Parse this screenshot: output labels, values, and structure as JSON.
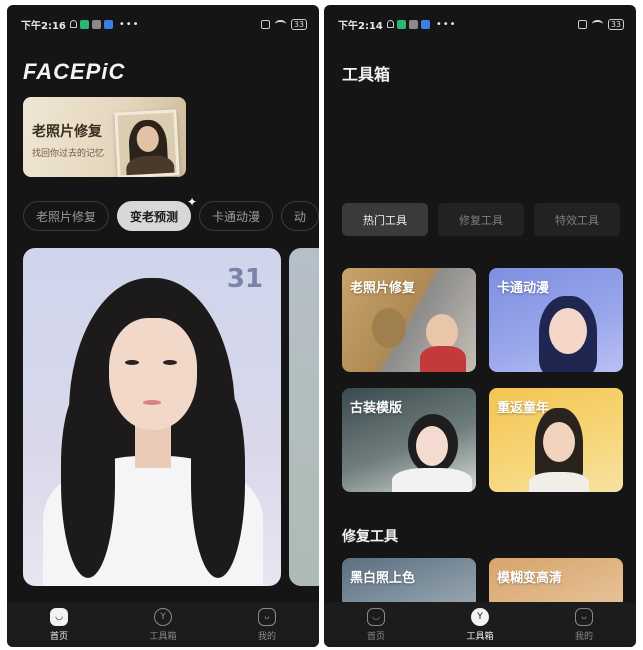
{
  "left": {
    "status": {
      "time": "下午2:16",
      "battery": "33"
    },
    "logo": "FACEPiC",
    "banner": {
      "title": "老照片修复",
      "subtitle": "找回你过去的记忆"
    },
    "chips": [
      "老照片修复",
      "变老预测",
      "卡通动漫",
      "动"
    ],
    "active_chip": "变老预测",
    "photo_card": {
      "age": "31"
    },
    "tabs": [
      {
        "label": "首页",
        "active": true,
        "icon": "home-icon"
      },
      {
        "label": "工具箱",
        "active": false,
        "icon": "toolbox-icon"
      },
      {
        "label": "我的",
        "active": false,
        "icon": "profile-icon"
      }
    ]
  },
  "right": {
    "status": {
      "time": "下午2:14",
      "battery": "33"
    },
    "title": "工具箱",
    "segments": [
      "热门工具",
      "修复工具",
      "特效工具"
    ],
    "active_segment": "热门工具",
    "tools": [
      "老照片修复",
      "卡通动漫",
      "古装模版",
      "重返童年"
    ],
    "section_title": "修复工具",
    "repair_tools": [
      "黑白照上色",
      "模糊变高清"
    ],
    "tabs": [
      {
        "label": "首页",
        "active": false,
        "icon": "home-icon"
      },
      {
        "label": "工具箱",
        "active": true,
        "icon": "toolbox-icon"
      },
      {
        "label": "我的",
        "active": false,
        "icon": "profile-icon"
      }
    ]
  }
}
